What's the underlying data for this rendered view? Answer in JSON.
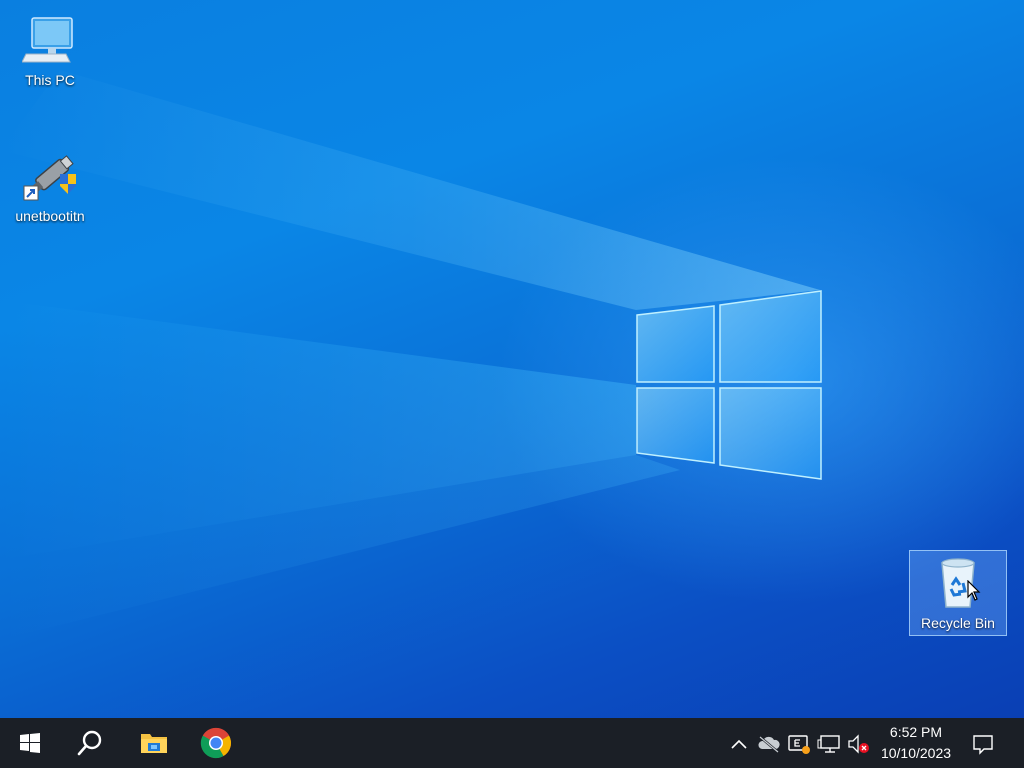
{
  "desktop": {
    "icons": [
      {
        "label": "This PC",
        "icon": "this-pc-icon"
      },
      {
        "label": "unetbootitn",
        "icon": "unetbootin-icon"
      },
      {
        "label": "Recycle Bin",
        "icon": "recycle-bin-icon",
        "selected": true
      }
    ]
  },
  "taskbar": {
    "start": {
      "icon": "windows-start-icon"
    },
    "search": {
      "icon": "search-icon"
    },
    "pinned": [
      {
        "icon": "file-explorer-icon"
      },
      {
        "icon": "chrome-icon"
      }
    ],
    "tray": [
      {
        "icon": "chevron-up-icon"
      },
      {
        "icon": "onedrive-offline-icon"
      },
      {
        "icon": "keyboard-input-icon"
      },
      {
        "icon": "network-icon"
      },
      {
        "icon": "volume-muted-icon"
      }
    ],
    "clock": {
      "time": "6:52 PM",
      "date": "10/10/2023"
    },
    "notifications": {
      "icon": "action-center-icon"
    }
  },
  "colors": {
    "wallpaper_blue": "#0a7fe0",
    "taskbar_bg": "#1b1f26",
    "muted_red": "#e81123",
    "warning_orange": "#f7a01a"
  }
}
